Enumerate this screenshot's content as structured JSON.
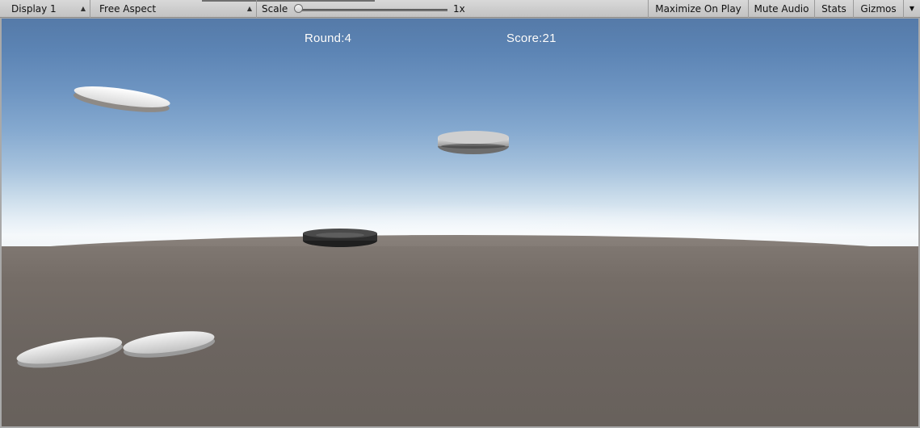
{
  "toolbar": {
    "display_label": "Display 1",
    "aspect_label": "Free Aspect",
    "scale_label": "Scale",
    "scale_value": "1x",
    "scale_fraction": 0.0,
    "maximize_label": "Maximize On Play",
    "mute_label": "Mute Audio",
    "stats_label": "Stats",
    "gizmos_label": "Gizmos"
  },
  "hud": {
    "round_text": "Round:4",
    "score_text": "Score:21"
  },
  "scene": {
    "disc_count": 5,
    "colors": {
      "sky_top": "#557aa8",
      "horizon": "#f4f8fb",
      "ground": "#6c6560",
      "disc_white": "#f2f2f2",
      "disc_gray": "#b9b9b9",
      "disc_black": "#2a2a2a"
    }
  }
}
